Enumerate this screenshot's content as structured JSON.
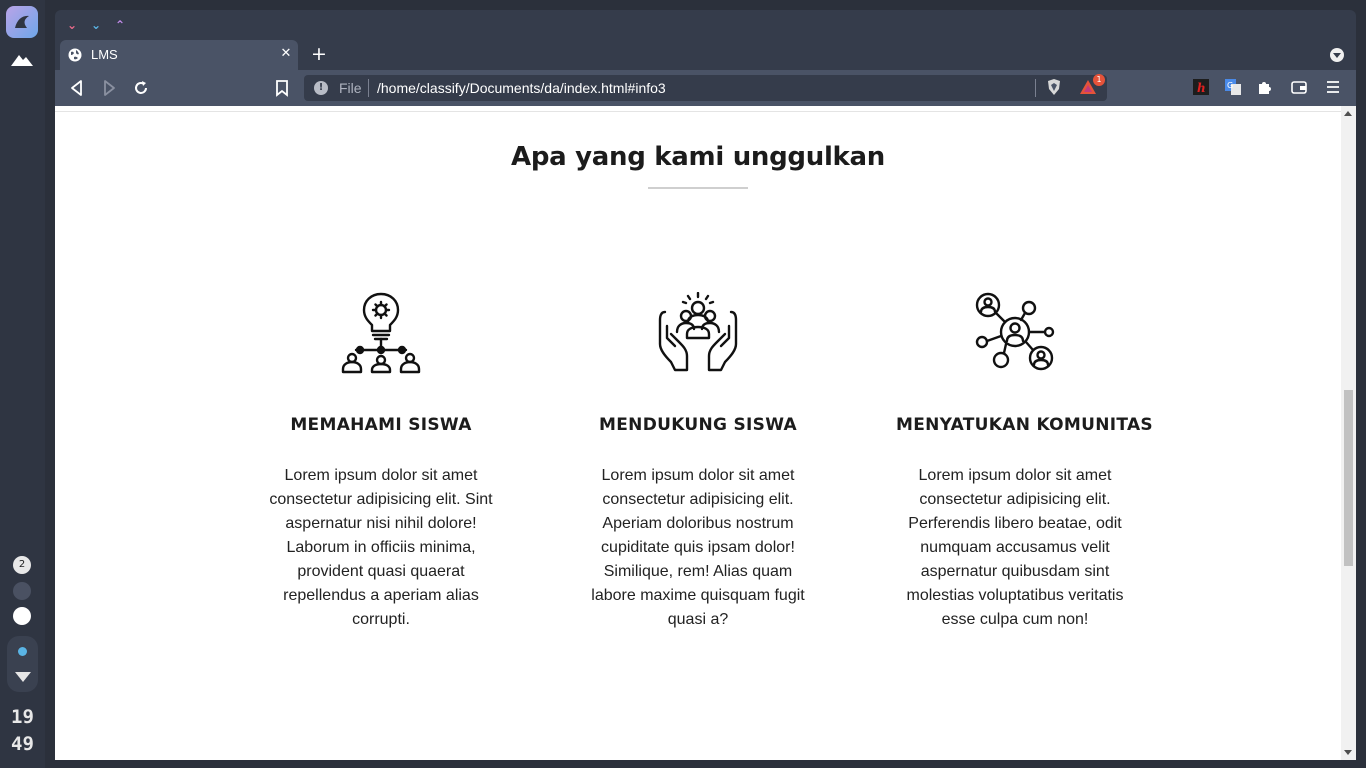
{
  "os": {
    "workspace_number": "2",
    "clock": {
      "hour": "19",
      "minute": "49"
    }
  },
  "browser": {
    "tab": {
      "title": "LMS"
    },
    "urlbar": {
      "scheme": "File",
      "url": "/home/classify/Documents/da/index.html#info3"
    },
    "notification_badge": "1"
  },
  "page": {
    "section_title": "Apa yang kami unggulkan",
    "features": [
      {
        "icon": "lightbulb-network-icon",
        "heading": "MEMAHAMI SISWA",
        "text": "Lorem ipsum dolor sit amet consectetur adipisicing elit. Sint aspernatur nisi nihil dolore! Laborum in officiis minima, provident quasi quaerat repellendus a aperiam alias corrupti."
      },
      {
        "icon": "hands-support-icon",
        "heading": "MENDUKUNG SISWA",
        "text": "Lorem ipsum dolor sit amet consectetur adipisicing elit. Aperiam doloribus nostrum cupiditate quis ipsam dolor! Similique, rem! Alias quam labore maxime quisquam fugit quasi a?"
      },
      {
        "icon": "community-network-icon",
        "heading": "MENYATUKAN KOMUNITAS",
        "text": "Lorem ipsum dolor sit amet consectetur adipisicing elit. Perferendis libero beatae, odit numquam accusamus velit aspernatur quibusdam sint molestias voluptatibus veritatis esse culpa cum non!"
      }
    ]
  }
}
